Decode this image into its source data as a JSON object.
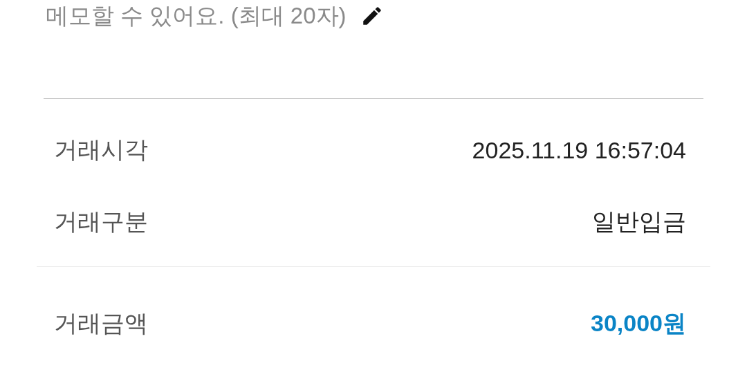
{
  "memo": {
    "placeholder": "메모할 수 있어요. (최대 20자)"
  },
  "details": [
    {
      "label": "거래시각",
      "value": "2025.11.19 16:57:04"
    },
    {
      "label": "거래구분",
      "value": "일반입금"
    }
  ],
  "amount": {
    "label": "거래금액",
    "value": "30,000원"
  }
}
